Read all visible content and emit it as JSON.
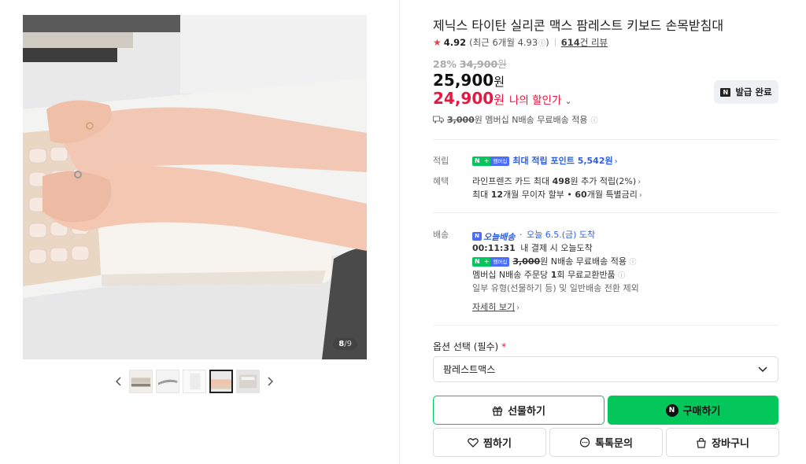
{
  "gallery": {
    "counter_current": "8",
    "counter_separator": "/",
    "counter_total": "9",
    "prev_icon": "chevron-left-icon",
    "next_icon": "chevron-right-icon",
    "thumbnails": [
      "thumb-1",
      "thumb-2",
      "thumb-3",
      "thumb-4",
      "thumb-5"
    ],
    "active_thumbnail": 4
  },
  "product": {
    "title": "제닉스 타이탄 실리콘 맥스 팜레스트 키보드 손목받침대",
    "rating": "4.92",
    "rating_recent": "(최근 6개월 4.93",
    "rating_recent_close": ")",
    "review_count": "614",
    "review_suffix": "건 리뷰"
  },
  "price": {
    "discount_rate": "28%",
    "original": "34,900",
    "original_unit": "원",
    "sale": "25,900",
    "sale_unit": "원",
    "my_price": "24,900",
    "my_price_unit": "원",
    "my_price_label": "나의 할인가",
    "coupon_button": "발급 완료",
    "shipping_fee": "3,000",
    "shipping_text": "원 멤버십 N배송 무료배송 적용",
    "accent_red": "#e8173f",
    "accent_green": "#03c75a"
  },
  "benefits": {
    "point_label": "적립",
    "point_badge_n": "N",
    "point_badge_plus": "+",
    "point_badge_member": "멤버십",
    "point_text": "최대 적립 포인트 5,542원",
    "benefit_label": "혜택",
    "benefit_line1_a": "라인프렌즈 카드 최대 ",
    "benefit_line1_b": "498",
    "benefit_line1_c": "원 추가 적립(2%)",
    "benefit_line2_a": "최대 ",
    "benefit_line2_b": "12",
    "benefit_line2_c": "개월 무이자 할부 • ",
    "benefit_line2_d": "60",
    "benefit_line2_e": "개월 특별금리"
  },
  "delivery": {
    "label": "배송",
    "today_badge": "오늘배송",
    "today_dot": "·",
    "today_date": "오늘 6.5.(금) 도착",
    "countdown": "00:11:31",
    "countdown_text": "내 결제 시 오늘도착",
    "member_fee": "3,000",
    "member_text": "원 N배송 무료배송 적용",
    "exchange_a": "멤버십 N배송 주문당 ",
    "exchange_b": "1",
    "exchange_c": "회 무료교환반품",
    "note": "일부 유형(선물하기 등) 및 일반배송 전환 제외",
    "more_link": "자세히 보기"
  },
  "options": {
    "label": "옵션 선택 (필수)",
    "required_mark": "*",
    "selected": "팜레스트맥스"
  },
  "actions": {
    "gift": "선물하기",
    "buy": "구매하기",
    "zzim": "찜하기",
    "talk": "톡톡문의",
    "cart": "장바구니"
  }
}
